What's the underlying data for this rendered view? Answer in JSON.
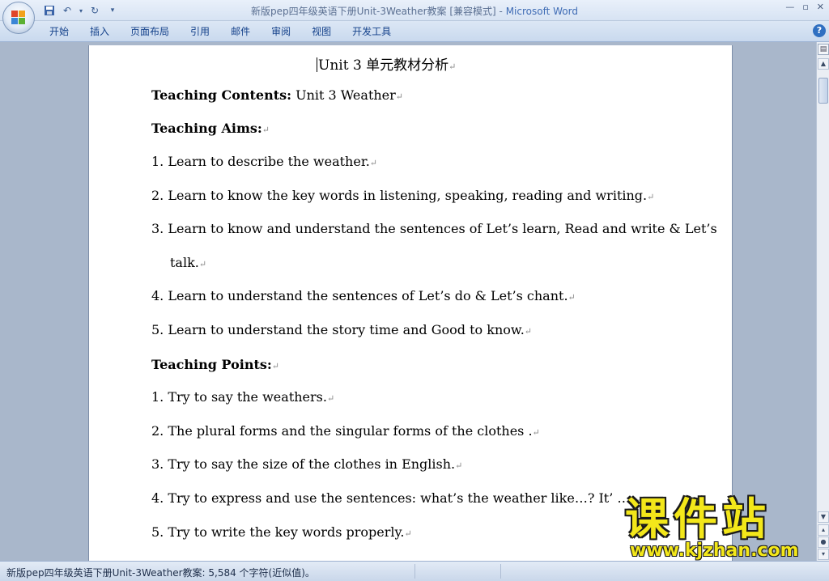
{
  "window": {
    "title_doc": "新版pep四年级英语下册Unit-3Weather教案 [兼容模式] - ",
    "title_app": "Microsoft Word",
    "controls": [
      "—",
      "▫",
      "✕"
    ]
  },
  "ribbon": {
    "tabs": [
      "开始",
      "插入",
      "页面布局",
      "引用",
      "邮件",
      "审阅",
      "视图",
      "开发工具"
    ],
    "help": "?"
  },
  "document": {
    "heading": "Unit 3 单元教材分析",
    "contents_label": "Teaching Contents:",
    "contents_value": " Unit 3 Weather",
    "aims_label": "Teaching Aims:",
    "aims": [
      "1.  Learn to describe the weather.",
      "2.  Learn to know the key words in listening, speaking, reading and writing.",
      "3.  Learn to know and understand the sentences of Let’s learn, Read and write & Let’s",
      "talk.",
      "4.  Learn to understand the sentences of Let’s do & Let’s chant.",
      "5.  Learn to understand the story time and Good to know."
    ],
    "points_label": "Teaching Points:",
    "points": [
      "1.  Try to say the weathers.",
      "2.  The plural forms and the singular forms of the clothes .",
      "3.  Try to say the size of the clothes in English.",
      "4. Try to express and use the sentences: what’s the weather like…?    It’ ….",
      "5. Try to write the key words properly."
    ],
    "para_mark": "↵"
  },
  "statusbar": {
    "text": "新版pep四年级英语下册Unit-3Weather教案: 5,584 个字符(近似值)。"
  },
  "watermark": {
    "cn": "课件站",
    "url": "www.kjzhan.com"
  }
}
